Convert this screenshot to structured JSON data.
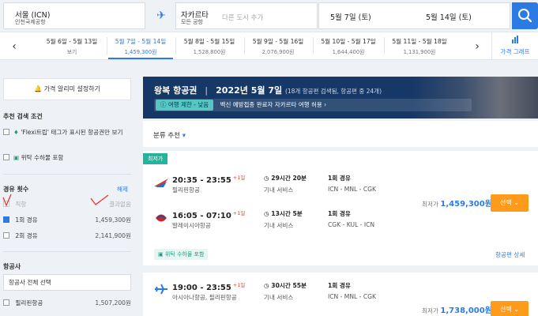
{
  "search": {
    "origin": "서울 (ICN)",
    "origin_sub": "인천국제공항",
    "destination": "자카르타",
    "destination_sub": "모든 공항",
    "add_city_placeholder": "다른 도시 추가",
    "depart_date": "5월 7일 (토)",
    "return_date": "5월 14일 (토)"
  },
  "date_strip": {
    "cells": [
      {
        "dates": "5월 6일 - 5월 13일",
        "price": "보기"
      },
      {
        "dates": "5월 7일 - 5월 14일",
        "price": "1,459,300원"
      },
      {
        "dates": "5월 8일 - 5월 15일",
        "price": "1,528,800원"
      },
      {
        "dates": "5월 9일 - 5월 16일",
        "price": "2,076,900원"
      },
      {
        "dates": "5월 10일 - 5월 17일",
        "price": "1,644,400원"
      },
      {
        "dates": "5월 11일 - 5월 18일",
        "price": "1,131,900원"
      }
    ],
    "price_graph": "가격 그래프"
  },
  "sidebar": {
    "price_alert": "가격 알리미 설정하기",
    "recommended_title": "추천 검색 조건",
    "flexi_label": "'Flexi트립' 태그가 표시된 항공권만 보기",
    "checked_bag_label": "위탁 수하물 포함",
    "stops_title": "경유 횟수",
    "stops_clear": "해제",
    "stops": [
      {
        "label": "직항",
        "price": "결과없음"
      },
      {
        "label": "1회 경유",
        "price": "1,459,300원"
      },
      {
        "label": "2회 경유",
        "price": "2,141,900원"
      }
    ],
    "airline_title": "항공사",
    "airline_select_all": "항공사 전체 선택",
    "airlines": [
      {
        "label": "필리핀항공",
        "price": "1,507,200원"
      }
    ]
  },
  "header": {
    "trip_type": "왕복 항공권",
    "date": "2022년 5월 7일",
    "summary": "(18개 항공편 검색됨, 항공편 중 24개)",
    "travel_badge": "여행 제한 - 낮음",
    "travel_note": "백신 예방접종 완료자 자카르타 여행 허용"
  },
  "sort": {
    "label": "분류 추천"
  },
  "results": [
    {
      "tag": "최저가",
      "legs": [
        {
          "time": "20:35 - 23:55",
          "plus": "+1일",
          "airline": "필리핀항공",
          "duration": "29시간 20분",
          "service": "기내 서비스",
          "stops": "1회 경유",
          "route": "ICN - MNL - CGK"
        },
        {
          "time": "16:05 - 07:10",
          "plus": "+1일",
          "airline": "말레이시아항공",
          "duration": "13시간 5분",
          "service": "기내 서비스",
          "stops": "1회 경유",
          "route": "CGK - KUL - ICN"
        }
      ],
      "price_label": "최저가",
      "price": "1,459,300원",
      "select": "선택",
      "luggage": "위탁 수하물 포함",
      "detail": "항공편 상세"
    },
    {
      "legs": [
        {
          "time": "19:00 - 23:55",
          "plus": "+1일",
          "airline": "아시아나항공, 필리핀항공",
          "duration": "30시간 55분",
          "service": "기내 서비스",
          "stops": "1회 경유",
          "route": "ICN - MNL - CGK"
        }
      ],
      "price_label": "최저가",
      "price": "1,738,000원",
      "select": "선택"
    }
  ],
  "colors": {
    "accent": "#2c7be5",
    "select_button": "#ff9b1a",
    "header_bg": "#163866",
    "tag": "#23b49e"
  }
}
